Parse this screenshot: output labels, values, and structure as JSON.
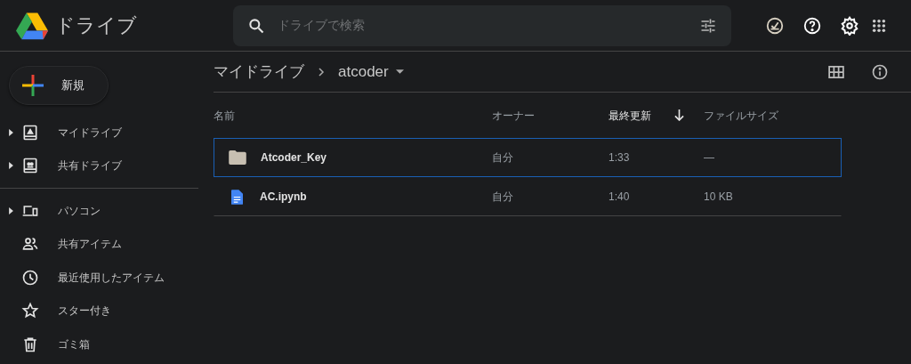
{
  "app": {
    "title": "ドライブ"
  },
  "search": {
    "placeholder": "ドライブで検索"
  },
  "new_button": {
    "label": "新規"
  },
  "sidebar": {
    "sections": [
      {
        "items": [
          {
            "label": "マイドライブ",
            "expandable": true
          },
          {
            "label": "共有ドライブ",
            "expandable": true
          }
        ]
      },
      {
        "items": [
          {
            "label": "パソコン",
            "expandable": true
          },
          {
            "label": "共有アイテム",
            "expandable": false
          },
          {
            "label": "最近使用したアイテム",
            "expandable": false
          },
          {
            "label": "スター付き",
            "expandable": false
          },
          {
            "label": "ゴミ箱",
            "expandable": false
          }
        ]
      }
    ]
  },
  "breadcrumb": [
    "マイドライブ",
    "atcoder"
  ],
  "table": {
    "columns": [
      {
        "label": "名前",
        "sorted": false
      },
      {
        "label": "オーナー",
        "sorted": false
      },
      {
        "label": "最終更新",
        "sorted": true
      },
      {
        "label": "ファイルサイズ",
        "sorted": false
      }
    ],
    "rows": [
      {
        "kind": "folder",
        "focused": true,
        "name": "Atcoder_Key",
        "owner": "自分",
        "modified": "1:33",
        "size": "—"
      },
      {
        "kind": "file",
        "focused": false,
        "name": "AC.ipynb",
        "owner": "自分",
        "modified": "1:40",
        "size": "10 KB"
      }
    ]
  }
}
